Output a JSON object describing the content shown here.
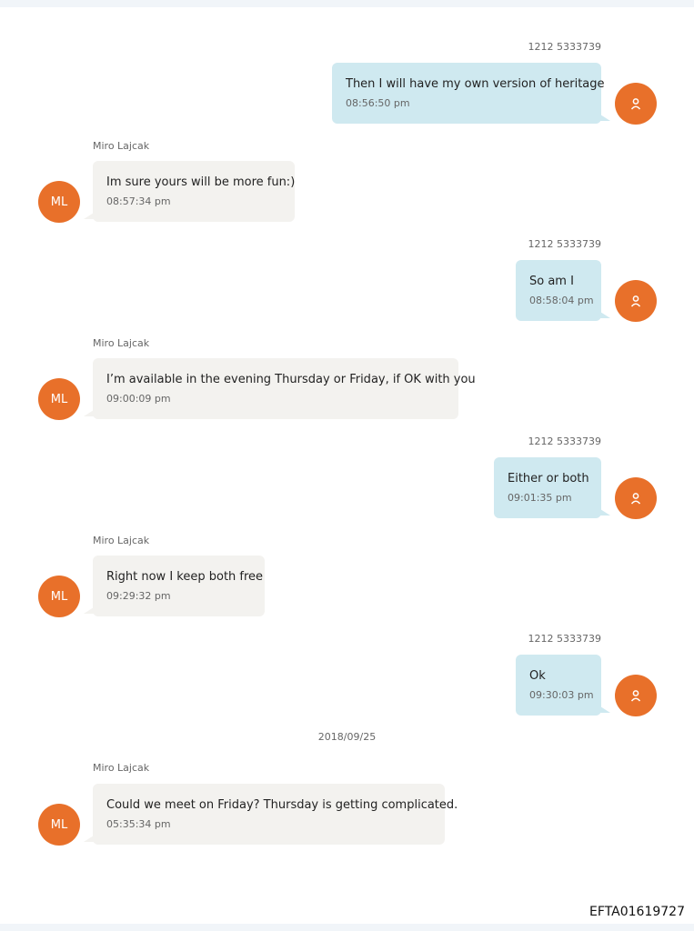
{
  "conversation": [
    {
      "direction": "out",
      "sender": "1212 5333739",
      "text": "Then I will have my own version of heritage",
      "time": "08:56:50 pm",
      "avatar_icon": "person-icon"
    },
    {
      "direction": "in",
      "sender": "Miro Lajcak",
      "text": "Im sure yours will be more fun:)",
      "time": "08:57:34 pm",
      "avatar_initials": "ML"
    },
    {
      "direction": "out",
      "sender": "1212 5333739",
      "text": "So am I",
      "time": "08:58:04 pm",
      "avatar_icon": "person-icon"
    },
    {
      "direction": "in",
      "sender": "Miro Lajcak",
      "text": "I’m available in the evening Thursday or Friday, if OK with you",
      "time": "09:00:09 pm",
      "avatar_initials": "ML"
    },
    {
      "direction": "out",
      "sender": "1212 5333739",
      "text": "Either or both",
      "time": "09:01:35 pm",
      "avatar_icon": "person-icon"
    },
    {
      "direction": "in",
      "sender": "Miro Lajcak",
      "text": "Right now I keep both free",
      "time": "09:29:32 pm",
      "avatar_initials": "ML"
    },
    {
      "direction": "out",
      "sender": "1212 5333739",
      "text": "Ok",
      "time": "09:30:03 pm",
      "avatar_icon": "person-icon"
    },
    {
      "direction": "in",
      "sender": "Miro Lajcak",
      "text": "Could we meet on Friday? Thursday is getting complicated.",
      "time": "05:35:34 pm",
      "avatar_initials": "ML"
    }
  ],
  "date_separator": "2018/09/25",
  "document_id": "EFTA01619727",
  "colors": {
    "outgoing_bubble": "#cfe9f0",
    "incoming_bubble": "#f3f2ef",
    "avatar": "#e8702a"
  }
}
